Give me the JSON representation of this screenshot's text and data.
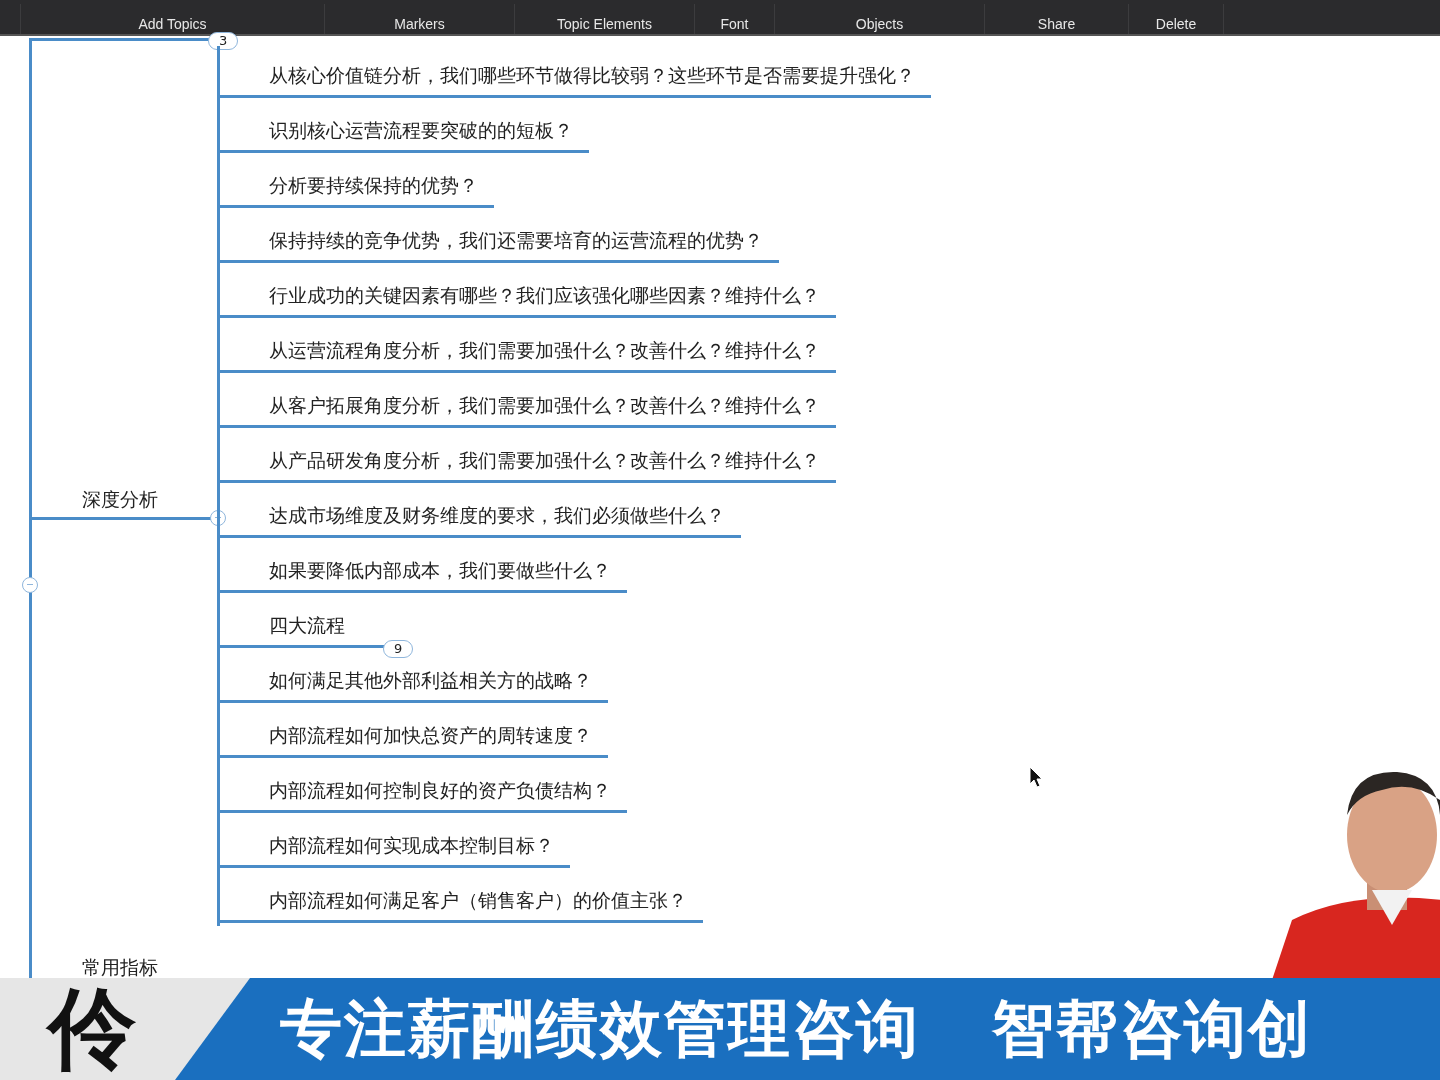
{
  "toolbar": {
    "items": [
      "Add Topics",
      "Markers",
      "Topic Elements",
      "Font",
      "Objects",
      "Share",
      "Delete"
    ]
  },
  "mindmap": {
    "top_badge": "3",
    "root_expanded": true,
    "branches": [
      {
        "label": "深度分析",
        "expanded": true,
        "topics": [
          {
            "text": "从核心价值链分析，我们哪些环节做得比较弱？这些环节是否需要提升强化？"
          },
          {
            "text": "识别核心运营流程要突破的的短板？"
          },
          {
            "text": "分析要持续保持的优势？"
          },
          {
            "text": "保持持续的竞争优势，我们还需要培育的运营流程的优势？"
          },
          {
            "text": "行业成功的关键因素有哪些？我们应该强化哪些因素？维持什么？"
          },
          {
            "text": "从运营流程角度分析，我们需要加强什么？改善什么？维持什么？"
          },
          {
            "text": "从客户拓展角度分析，我们需要加强什么？改善什么？维持什么？"
          },
          {
            "text": "从产品研发角度分析，我们需要加强什么？改善什么？维持什么？"
          },
          {
            "text": "达成市场维度及财务维度的要求，我们必须做些什么？"
          },
          {
            "text": "如果要降低内部成本，我们要做些什么？"
          },
          {
            "text": "四大流程",
            "badge": "9"
          },
          {
            "text": "如何满足其他外部利益相关方的战略？"
          },
          {
            "text": "内部流程如何加快总资产的周转速度？"
          },
          {
            "text": "内部流程如何控制良好的资产负债结构？"
          },
          {
            "text": "内部流程如何实现成本控制目标？"
          },
          {
            "text": "内部流程如何满足客户（销售客户）的价值主张？"
          }
        ]
      },
      {
        "label": "常用指标"
      }
    ]
  },
  "banner": {
    "logo": "伶",
    "text": "专注薪酬绩效管理咨询",
    "text_2": "智帮咨询创"
  }
}
